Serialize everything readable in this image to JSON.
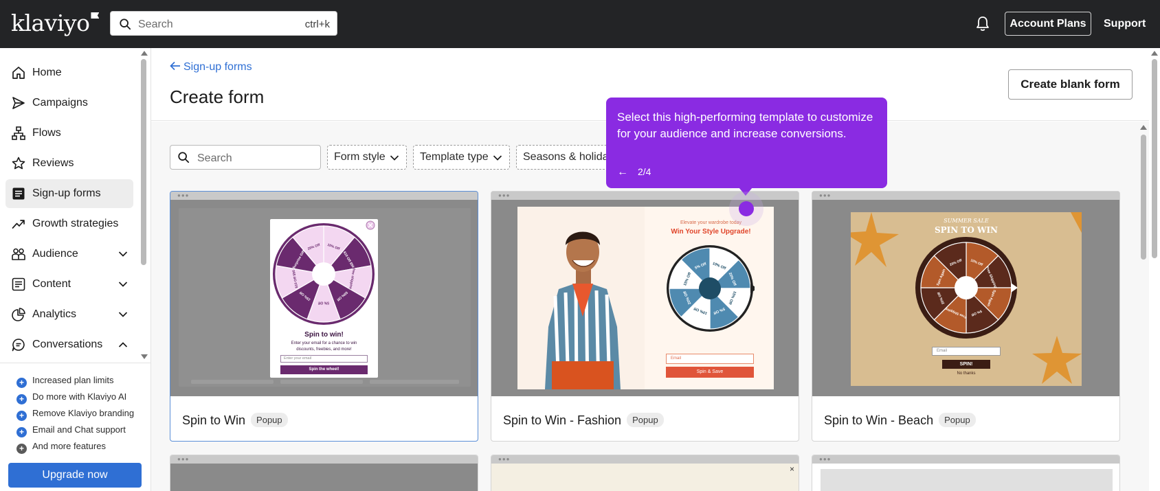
{
  "topbar": {
    "logo": "klaviyo",
    "search_placeholder": "Search",
    "search_shortcut": "ctrl+k",
    "account_plans": "Account Plans",
    "support": "Support"
  },
  "sidebar": {
    "items": [
      {
        "label": "Home",
        "icon": "home-icon"
      },
      {
        "label": "Campaigns",
        "icon": "send-icon"
      },
      {
        "label": "Flows",
        "icon": "flow-icon"
      },
      {
        "label": "Reviews",
        "icon": "star-icon"
      },
      {
        "label": "Sign-up forms",
        "icon": "form-icon",
        "active": true
      },
      {
        "label": "Growth strategies",
        "icon": "trend-icon"
      },
      {
        "label": "Audience",
        "icon": "people-icon",
        "expandable": true
      },
      {
        "label": "Content",
        "icon": "content-icon",
        "expandable": true
      },
      {
        "label": "Analytics",
        "icon": "pie-icon",
        "expandable": true
      },
      {
        "label": "Conversations",
        "icon": "chat-icon",
        "expanded": true
      }
    ],
    "features": [
      "Increased plan limits",
      "Do more with Klaviyo AI",
      "Remove Klaviyo branding",
      "Email and Chat support",
      "And more features"
    ],
    "upgrade": "Upgrade now"
  },
  "main": {
    "breadcrumb": "Sign-up forms",
    "title": "Create form",
    "create_blank": "Create blank form",
    "search_placeholder": "Search",
    "filters": [
      "Form style",
      "Template type",
      "Seasons & holidays"
    ]
  },
  "cards": [
    {
      "title": "Spin to Win",
      "badge": "Popup",
      "preview": {
        "heading": "Spin to win!",
        "body": "Enter your email for a chance to win discounts, freebies, and more!",
        "input": "Enter your email",
        "button": "Spin the wheel!",
        "slices": [
          "10% Off",
          "$10 Off $50",
          "free shipping",
          "50% Off",
          "5% Off",
          "15% Off",
          "$10 Off $50",
          "Surprise Gift",
          "20% Off"
        ]
      }
    },
    {
      "title": "Spin to Win - Fashion",
      "badge": "Popup",
      "preview": {
        "eyebrow": "Elevate your wardrobe today",
        "heading": "Win Your Style Upgrade!",
        "input": "Email",
        "button": "Spin & Save",
        "slices": [
          "10% Off",
          "20% Off",
          "15% Off",
          "5% Off",
          "10% Off",
          "20% Off",
          "15% Off",
          "5% Off"
        ]
      }
    },
    {
      "title": "Spin to Win - Beach",
      "badge": "Popup",
      "preview": {
        "eyebrow": "SUMMER SALE",
        "heading": "SPIN TO WIN",
        "input": "Email",
        "button": "SPIN!",
        "decline": "No thanks",
        "slices": [
          "10% Off",
          "Free Shipping",
          "Spin Again",
          "5% Off",
          "Free Shipping",
          "20% Off",
          "Spin Again",
          "20% Off"
        ]
      }
    }
  ],
  "tooltip": {
    "text": "Select this high-performing template to customize for your audience and increase conversions.",
    "step": "2/4"
  },
  "colors": {
    "accent": "#2f6fd4",
    "tooltip": "#8a2be2",
    "topbar": "#232426"
  }
}
